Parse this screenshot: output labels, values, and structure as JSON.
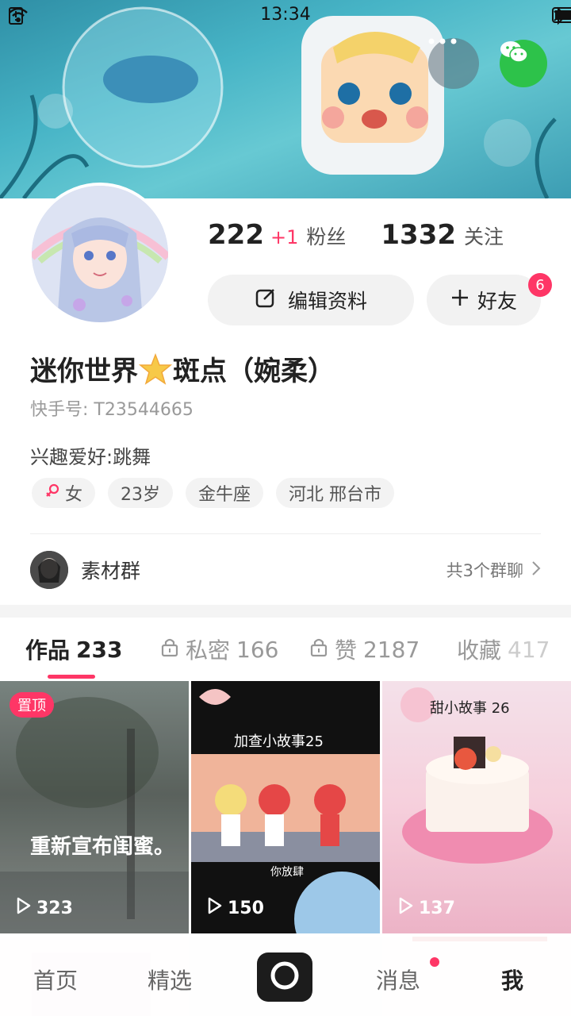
{
  "status_bar": {
    "time": "13:34",
    "icons": [
      "sim-alert-icon",
      "wifi-icon",
      "bluetooth-icon",
      "battery-icon"
    ]
  },
  "header_actions": {
    "more_icon": "more-dots-icon",
    "share_icon": "wechat-icon"
  },
  "stats": {
    "followers": {
      "count": "222",
      "delta": "+1",
      "label": "粉丝"
    },
    "following": {
      "count": "1332",
      "label": "关注"
    }
  },
  "buttons": {
    "edit_profile": "编辑资料",
    "add_friend": "好友",
    "friend_badge": "6"
  },
  "profile": {
    "nickname": "迷你世界",
    "nickname_suffix": "斑点（婉柔）",
    "user_id": "快手号: T23544665",
    "interest": "兴趣爱好:跳舞"
  },
  "tags": [
    {
      "icon": "female-icon",
      "label": "女"
    },
    {
      "label": "23岁"
    },
    {
      "label": "金牛座"
    },
    {
      "label": "河北 邢台市"
    }
  ],
  "group": {
    "name": "素材群",
    "count_text": "共3个群聊"
  },
  "tabs": [
    {
      "label": "作品",
      "count": "233",
      "locked": false
    },
    {
      "label": "私密",
      "count": "166",
      "locked": true
    },
    {
      "label": "赞",
      "count": "2187",
      "locked": true
    },
    {
      "label": "收藏",
      "count": "417",
      "locked": false
    }
  ],
  "videos": [
    {
      "badge": "置顶",
      "caption": "重新宣布闺蜜。",
      "plays": "323"
    },
    {
      "title": "加查小故事25",
      "subtitle": "你放肆",
      "plays": "150"
    },
    {
      "title": "甜小故事 26",
      "plays": "137"
    }
  ],
  "bottom_nav": {
    "home": "首页",
    "featured": "精选",
    "messages": "消息",
    "me": "我"
  },
  "colors": {
    "accent": "#fe3666",
    "wechat": "#2dc24a"
  }
}
